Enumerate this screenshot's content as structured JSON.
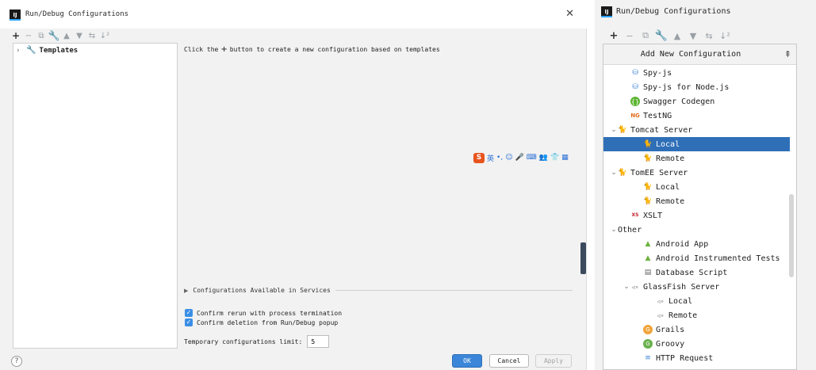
{
  "dialog": {
    "title": "Run/Debug Configurations",
    "app_icon": "IJ",
    "close_icon": "✕",
    "toolbar": [
      "+",
      "−",
      "⧉",
      "🔧",
      "▲",
      "▼",
      "⇆",
      "↓²"
    ],
    "tree": {
      "caret": "›",
      "icon": "wrench-icon",
      "label": "Templates"
    },
    "hint_before": "Click the",
    "hint_plus": "+",
    "hint_after": "button to create a new configuration based on templates",
    "services_label": "Configurations Available in Services",
    "confirm_rerun": "Confirm rerun with process termination",
    "confirm_deletion": "Confirm deletion from Run/Debug popup",
    "limit_label": "Temporary configurations limit:",
    "limit_value": "5",
    "help": "?",
    "ok": "OK",
    "cancel": "Cancel",
    "apply": "Apply"
  },
  "ime": {
    "logo": "S",
    "lang": "英",
    "items": [
      "•,",
      "☺",
      "🎤",
      "⌨",
      "👥",
      "👕",
      "▦"
    ]
  },
  "popup_window": {
    "title": "Run/Debug Configurations",
    "app_icon": "IJ",
    "toolbar": [
      "+",
      "−",
      "⧉",
      "🔧",
      "▲",
      "▼",
      "⇆",
      "↓²"
    ]
  },
  "popup": {
    "title": "Add New Configuration",
    "collapse_icon": "⇞",
    "items": [
      {
        "label": "Spy-js",
        "indent": 1,
        "caret": "",
        "icon": "spy",
        "glyph": "⛁"
      },
      {
        "label": "Spy-js for Node.js",
        "indent": 1,
        "caret": "",
        "icon": "spy",
        "glyph": "⛁"
      },
      {
        "label": "Swagger Codegen",
        "indent": 1,
        "caret": "",
        "icon": "swag",
        "glyph": "{}"
      },
      {
        "label": "TestNG",
        "indent": 1,
        "caret": "",
        "icon": "ng",
        "glyph": "NG"
      },
      {
        "label": "Tomcat Server",
        "indent": 0,
        "caret": "⌄",
        "icon": "cat",
        "glyph": "🐈"
      },
      {
        "label": "Local",
        "indent": 2,
        "caret": "",
        "icon": "cat",
        "glyph": "🐈",
        "selected": true
      },
      {
        "label": "Remote",
        "indent": 2,
        "caret": "",
        "icon": "cat",
        "glyph": "🐈"
      },
      {
        "label": "TomEE Server",
        "indent": 0,
        "caret": "⌄",
        "icon": "cat",
        "glyph": "🐈"
      },
      {
        "label": "Local",
        "indent": 2,
        "caret": "",
        "icon": "cat",
        "glyph": "🐈"
      },
      {
        "label": "Remote",
        "indent": 2,
        "caret": "",
        "icon": "cat",
        "glyph": "🐈"
      },
      {
        "label": "XSLT",
        "indent": 1,
        "caret": "",
        "icon": "xslt",
        "glyph": "XS"
      },
      {
        "label": "Other",
        "indent": 0,
        "caret": "⌄",
        "icon": "",
        "glyph": ""
      },
      {
        "label": "Android App",
        "indent": 2,
        "caret": "",
        "icon": "andr",
        "glyph": "▲"
      },
      {
        "label": "Android Instrumented Tests",
        "indent": 2,
        "caret": "",
        "icon": "andr",
        "glyph": "▲"
      },
      {
        "label": "Database Script",
        "indent": 2,
        "caret": "",
        "icon": "db",
        "glyph": "▤"
      },
      {
        "label": "GlassFish Server",
        "indent": 1,
        "caret": "⌄",
        "icon": "fish",
        "glyph": "◃∘"
      },
      {
        "label": "Local",
        "indent": 3,
        "caret": "",
        "icon": "fish",
        "glyph": "◃∘"
      },
      {
        "label": "Remote",
        "indent": 3,
        "caret": "",
        "icon": "fish",
        "glyph": "◃∘"
      },
      {
        "label": "Grails",
        "indent": 2,
        "caret": "",
        "icon": "grails",
        "glyph": "G"
      },
      {
        "label": "Groovy",
        "indent": 2,
        "caret": "",
        "icon": "groovy",
        "glyph": "G"
      },
      {
        "label": "HTTP Request",
        "indent": 2,
        "caret": "",
        "icon": "http",
        "glyph": "≡"
      }
    ]
  }
}
